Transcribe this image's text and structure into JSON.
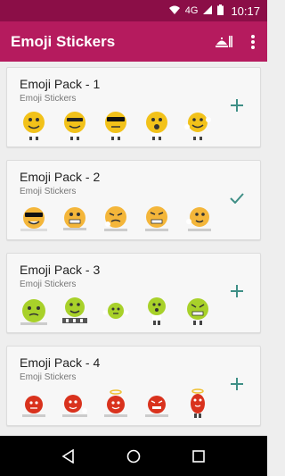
{
  "status_bar": {
    "network": "4G",
    "time": "10:17"
  },
  "app_bar": {
    "title": "Emoji Stickers"
  },
  "packs": [
    {
      "title": "Emoji Pack - 1",
      "subtitle": "Emoji Stickers",
      "state": "add",
      "face_color": "#f2c21a"
    },
    {
      "title": "Emoji Pack - 2",
      "subtitle": "Emoji Stickers",
      "state": "added",
      "face_color": "#f4b63a"
    },
    {
      "title": "Emoji Pack - 3",
      "subtitle": "Emoji Stickers",
      "state": "add",
      "face_color": "#a8d12a"
    },
    {
      "title": "Emoji Pack - 4",
      "subtitle": "Emoji Stickers",
      "state": "add",
      "face_color": "#d9321d"
    }
  ],
  "colors": {
    "status_bar": "#8b0e47",
    "app_bar": "#b51b5e",
    "accent": "#3f8f86"
  }
}
